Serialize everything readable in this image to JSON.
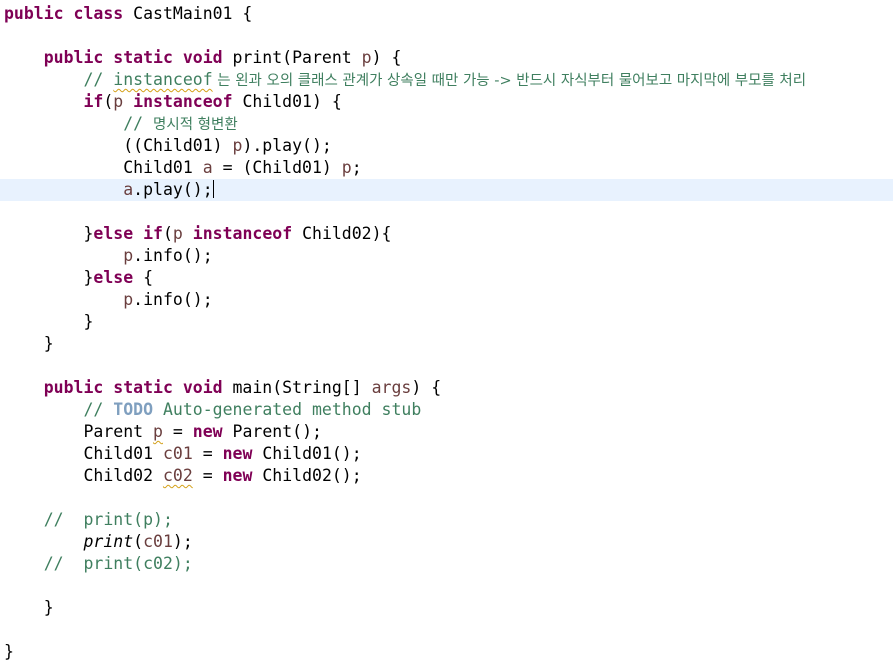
{
  "editor": {
    "language": "Java",
    "class_name": "CastMain01",
    "current_line_index": 8,
    "lines": [
      {
        "t1": "public class",
        "t2": " CastMain01 {"
      },
      {},
      {
        "t0": "    ",
        "t1": "public static void",
        "t2": " print(Parent ",
        "t3": "p",
        "t4": ") {"
      },
      {
        "t0": "        ",
        "t1": "// ",
        "t2": "instanceof",
        "t3": " 는 왼과 오의 클래스 관계가 상속일 때만 가능 -> 반드시 자식부터 물어보고 마지막에 부모를 처리"
      },
      {
        "t0": "        ",
        "t1": "if",
        "t2": "(",
        "t3": "p",
        "t4": " ",
        "t5": "instanceof",
        "t6": " Child01) {"
      },
      {
        "t0": "            ",
        "t1": "// ",
        "t2": "명시적 형변환"
      },
      {
        "t0": "            ",
        "t1": "((Child01) ",
        "t2": "p",
        "t3": ").play();"
      },
      {
        "t0": "            ",
        "t1": "Child01 ",
        "t2": "a",
        "t3": " = (Child01) ",
        "t4": "p",
        "t5": ";"
      },
      {
        "t0": "            ",
        "t1": "a",
        "t2": ".play();"
      },
      {},
      {
        "t0": "        ",
        "t1": "}",
        "t2": "else",
        "t3": " ",
        "t4": "if",
        "t5": "(",
        "t6": "p",
        "t7": " ",
        "t8": "instanceof",
        "t9": " Child02){"
      },
      {
        "t0": "            ",
        "t1": "p",
        "t2": ".info();"
      },
      {
        "t0": "        ",
        "t1": "}",
        "t2": "else",
        "t3": " {"
      },
      {
        "t0": "            ",
        "t1": "p",
        "t2": ".info();"
      },
      {
        "t0": "        ",
        "t1": "}"
      },
      {
        "t0": "    ",
        "t1": "}"
      },
      {},
      {
        "t0": "    ",
        "t1": "public static void",
        "t2": " main(String[] ",
        "t3": "args",
        "t4": ") {"
      },
      {
        "t0": "        ",
        "t1": "// ",
        "t2": "TODO",
        "t3": " Auto-generated method stub"
      },
      {
        "t0": "        ",
        "t1": "Parent ",
        "t2": "p",
        "t3": " = ",
        "t4": "new",
        "t5": " Parent();"
      },
      {
        "t0": "        ",
        "t1": "Child01 ",
        "t2": "c01",
        "t3": " = ",
        "t4": "new",
        "t5": " Child01();"
      },
      {
        "t0": "        ",
        "t1": "Child02 ",
        "t2": "c02",
        "t3": " = ",
        "t4": "new",
        "t5": " Child02();"
      },
      {},
      {
        "t0": "    ",
        "t1": "//  print(p);"
      },
      {
        "t0": "        ",
        "t1": "print",
        "t2": "(",
        "t3": "c01",
        "t4": ");"
      },
      {
        "t0": "    ",
        "t1": "//  print(c02);"
      },
      {},
      {
        "t0": "    ",
        "t1": "}"
      },
      {},
      {
        "t1": "}"
      }
    ]
  }
}
